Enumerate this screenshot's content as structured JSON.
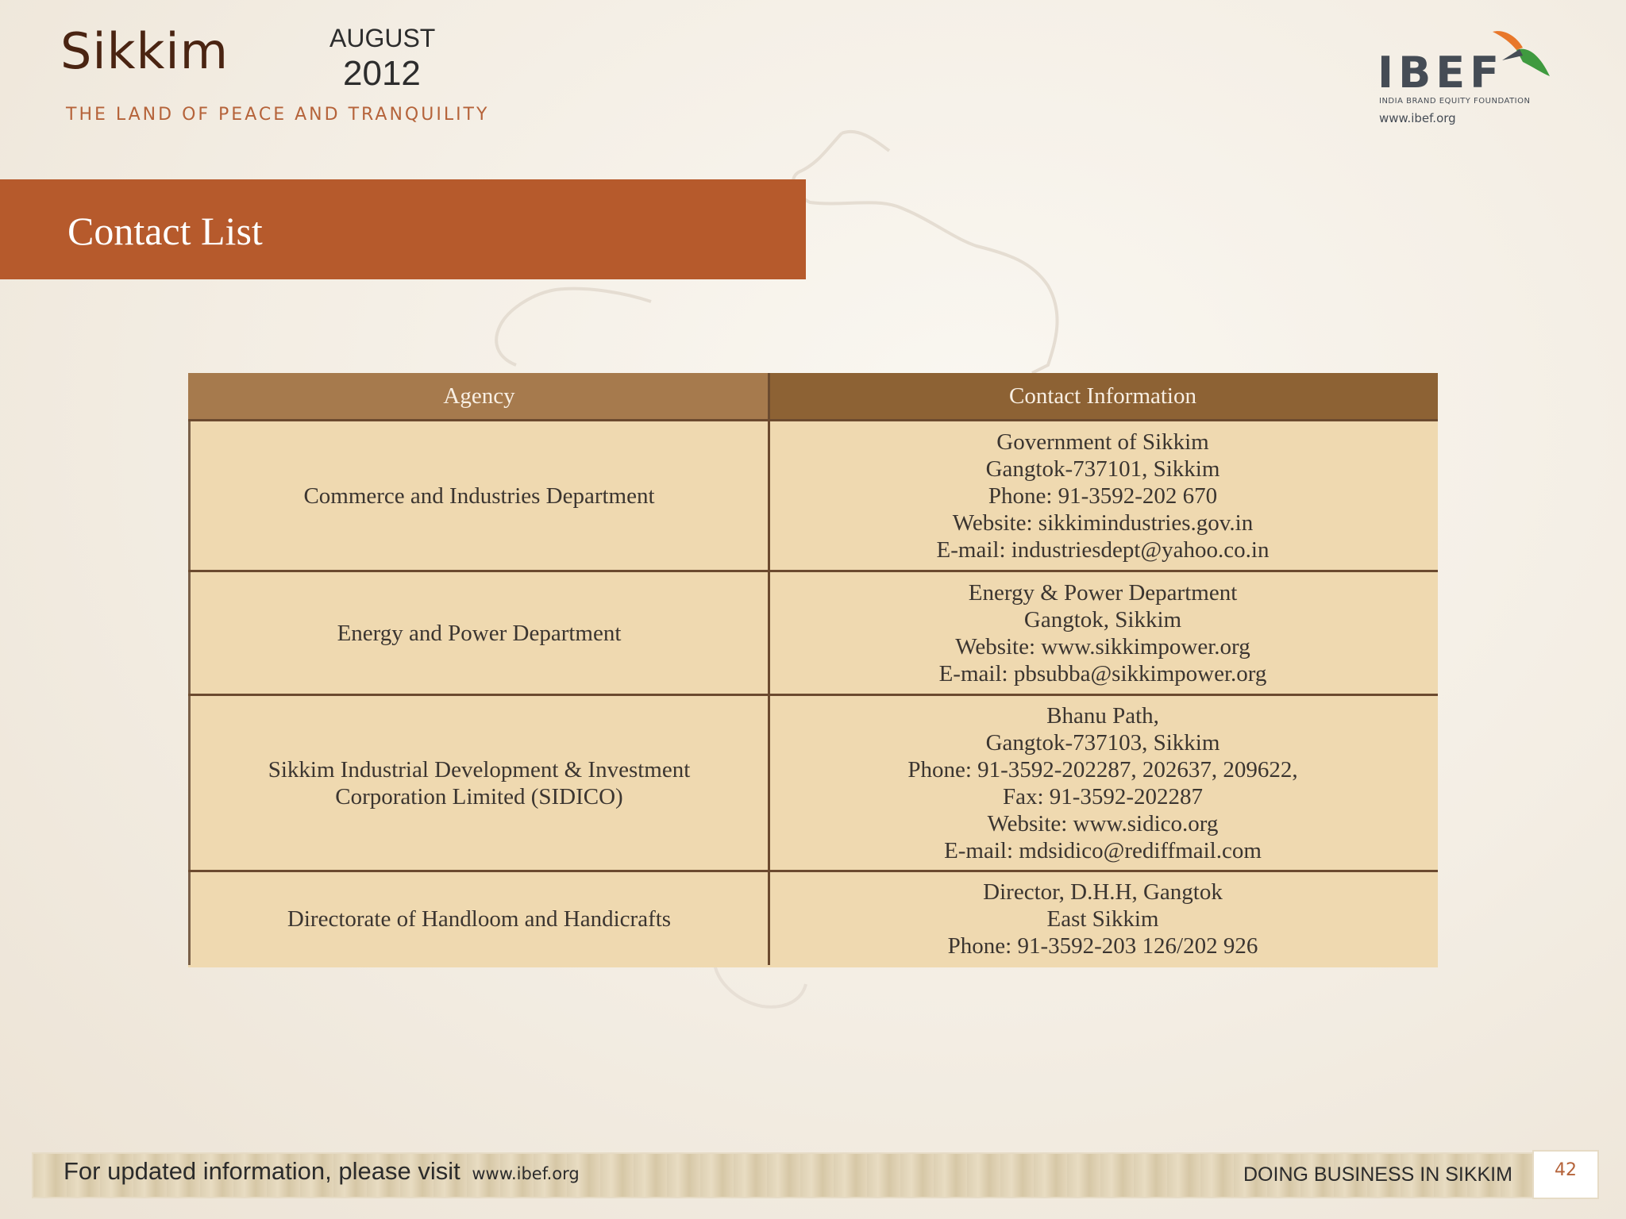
{
  "header": {
    "title": "Sikkim",
    "month": "AUGUST",
    "year": "2012",
    "tagline": "THE LAND OF PEACE AND TRANQUILITY"
  },
  "logo": {
    "name": "IBEF",
    "subtitle": "INDIA BRAND EQUITY FOUNDATION",
    "url": "www.ibef.org",
    "colors": {
      "text": "#454c55",
      "orange": "#e8772a",
      "green": "#3f9a3f"
    }
  },
  "section": {
    "title": "Contact List",
    "color": "#b65a2c"
  },
  "table": {
    "headers": [
      "Agency",
      "Contact Information"
    ],
    "rows": [
      {
        "agency": [
          "Commerce and Industries Department"
        ],
        "contact": [
          "Government of Sikkim",
          "Gangtok-737101, Sikkim",
          "Phone: 91-3592-202 670",
          "Website: sikkimindustries.gov.in",
          "E-mail: industriesdept@yahoo.co.in"
        ]
      },
      {
        "agency": [
          "Energy and Power Department"
        ],
        "contact": [
          "Energy & Power Department",
          "Gangtok, Sikkim",
          "Website: www.sikkimpower.org",
          "E-mail: pbsubba@sikkimpower.org"
        ]
      },
      {
        "agency": [
          "Sikkim Industrial Development & Investment",
          "Corporation Limited (SIDICO)"
        ],
        "contact": [
          "Bhanu Path,",
          "Gangtok-737103, Sikkim",
          "Phone: 91-3592-202287, 202637, 209622,",
          "Fax: 91-3592-202287",
          "Website: www.sidico.org",
          "E-mail: mdsidico@rediffmail.com"
        ]
      },
      {
        "agency": [
          "Directorate of Handloom and Handicrafts"
        ],
        "contact": [
          "Director, D.H.H, Gangtok",
          "East Sikkim",
          "Phone: 91-3592-203 126/202 926"
        ]
      }
    ]
  },
  "footer": {
    "text": "For updated information, please visit",
    "link": "www.ibef.org",
    "right": "DOING BUSINESS IN SIKKIM",
    "page": "42"
  }
}
